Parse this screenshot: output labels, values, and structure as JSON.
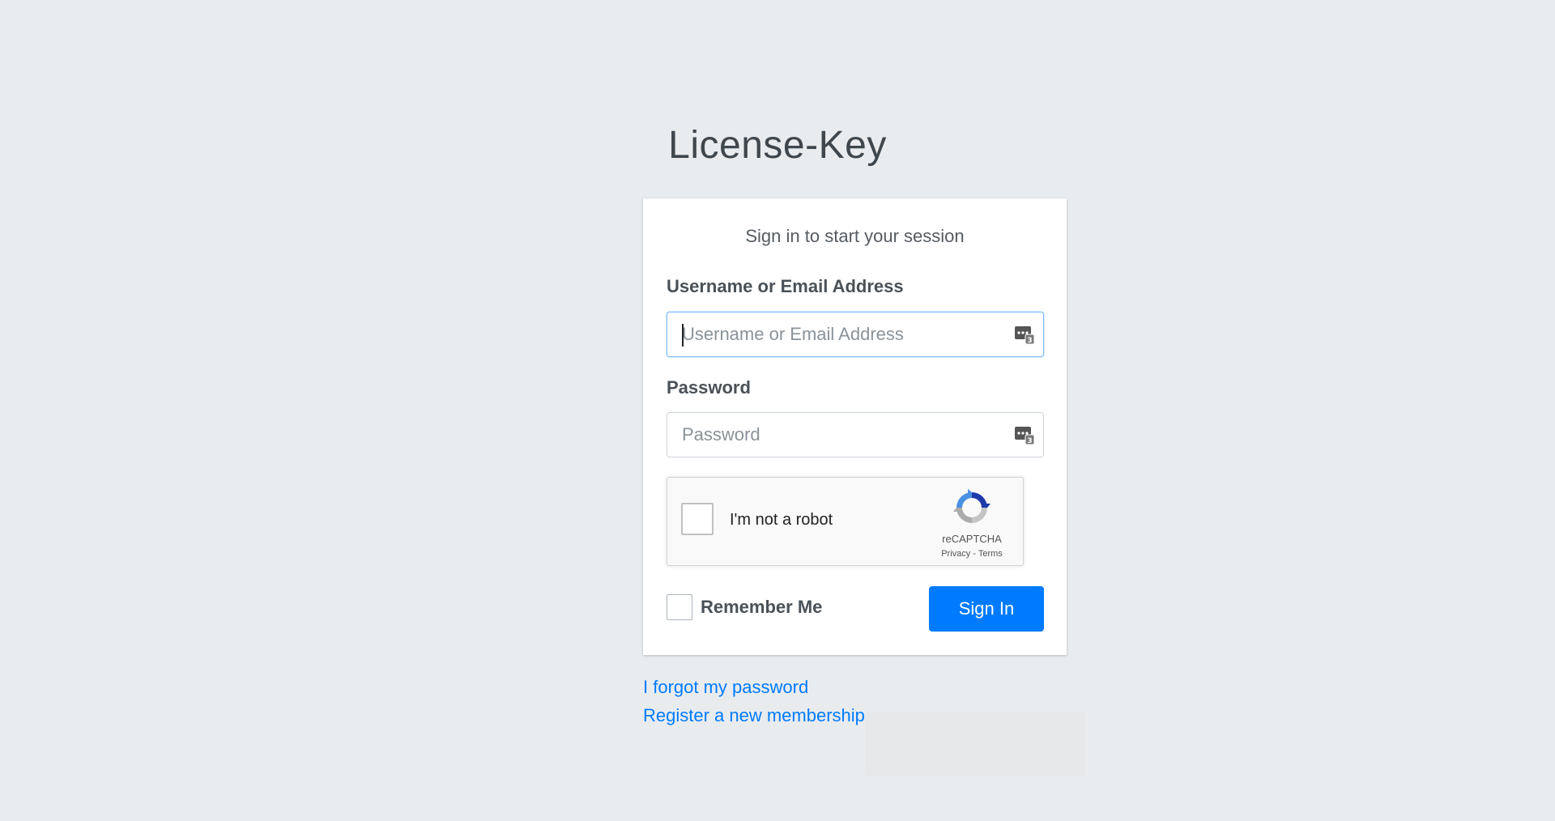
{
  "brand": {
    "title": "License-Key"
  },
  "card": {
    "message": "Sign in to start your session"
  },
  "username": {
    "label": "Username or Email Address",
    "placeholder": "Username or Email Address",
    "value": ""
  },
  "password": {
    "label": "Password",
    "placeholder": "Password",
    "value": ""
  },
  "captcha": {
    "label": "I'm not a robot",
    "brand": "reCAPTCHA",
    "privacy": "Privacy",
    "separator": " - ",
    "terms": "Terms",
    "checked": false
  },
  "remember": {
    "label": "Remember Me",
    "checked": false
  },
  "signin": {
    "label": "Sign In"
  },
  "links": {
    "forgot": "I forgot my password",
    "register": "Register a new membership"
  },
  "colors": {
    "primary": "#007bff",
    "background": "#e9ecef",
    "focus_border": "#80bdff"
  },
  "icons": {
    "field_icon": "password-manager-icon",
    "captcha_logo": "recaptcha-logo-icon"
  }
}
